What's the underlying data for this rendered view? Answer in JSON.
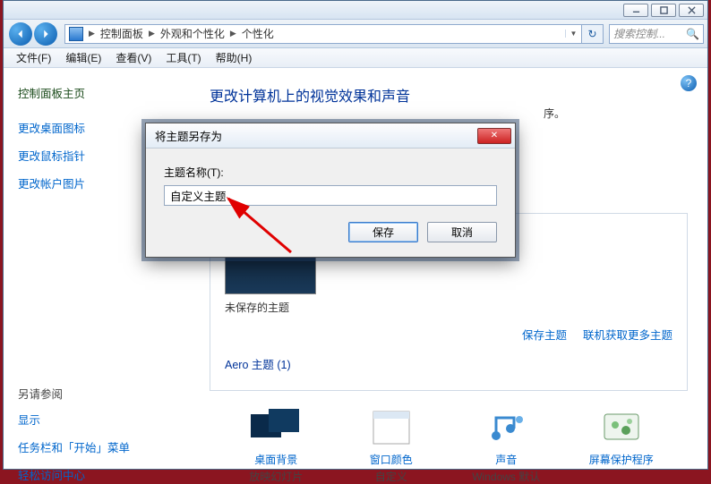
{
  "addressbar": {
    "crumbs": [
      "控制面板",
      "外观和个性化",
      "个性化"
    ],
    "search_placeholder": "搜索控制..."
  },
  "menu": {
    "file": "文件(F)",
    "edit": "编辑(E)",
    "view": "查看(V)",
    "tools": "工具(T)",
    "help": "帮助(H)"
  },
  "sidebar": {
    "home": "控制面板主页",
    "desktop_icons": "更改桌面图标",
    "mouse_pointers": "更改鼠标指针",
    "account_picture": "更改帐户图片",
    "see_also_header": "另请参阅",
    "display": "显示",
    "taskbar": "任务栏和「开始」菜单",
    "ease": "轻松访问中心"
  },
  "content": {
    "page_title": "更改计算机上的视觉效果和声音",
    "instruction_tail": "序。",
    "unsaved_theme": "未保存的主题",
    "save_theme_link": "保存主题",
    "more_themes_link": "联机获取更多主题",
    "aero_group": "Aero 主题 (1)"
  },
  "bottom": {
    "bg_title": "桌面背景",
    "bg_sub": "放映幻灯片",
    "color_title": "窗口颜色",
    "color_sub": "自定义",
    "sound_title": "声音",
    "sound_sub": "Windows 默认",
    "saver_title": "屏幕保护程序"
  },
  "dialog": {
    "title": "将主题另存为",
    "label": "主题名称(T):",
    "value": "自定义主题",
    "save": "保存",
    "cancel": "取消"
  }
}
